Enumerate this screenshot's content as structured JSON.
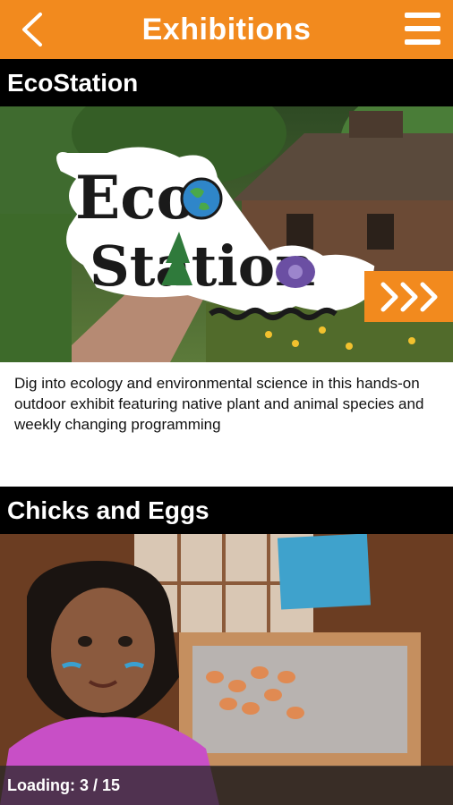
{
  "app": {
    "title": "Exhibitions"
  },
  "nav": {
    "back_icon": "chevron-left-icon",
    "menu_icon": "hamburger-menu-icon"
  },
  "exhibits": [
    {
      "title": "EcoStation",
      "description": "Dig into ecology and environmental science in this hands-on outdoor exhibit featuring native plant and animal species and weekly changing programming",
      "logo_line1": "Eco",
      "logo_line2": "Station"
    },
    {
      "title": "Chicks and Eggs"
    }
  ],
  "status": {
    "loading_text": "Loading: 3 / 15"
  },
  "colors": {
    "accent": "#f28a1e",
    "header": "#000000",
    "text": "#111111"
  }
}
